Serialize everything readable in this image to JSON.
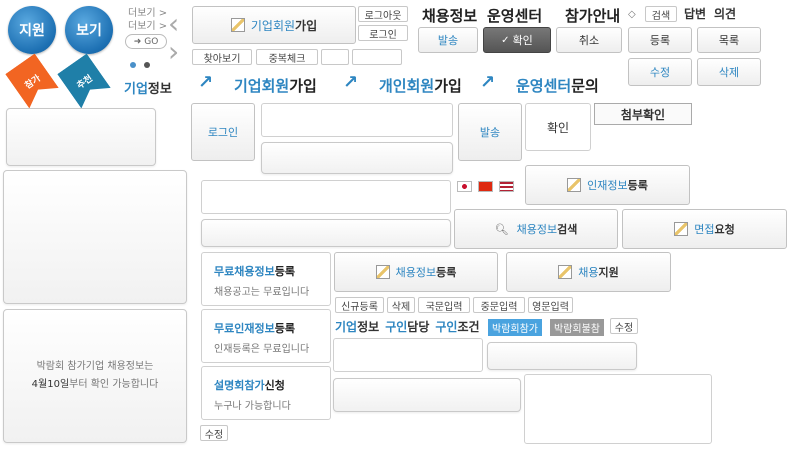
{
  "top_circles": [
    {
      "label": "지원"
    },
    {
      "label": "보기"
    }
  ],
  "ribbons": [
    {
      "label": "참가",
      "color": "#f26522"
    },
    {
      "label": "추천",
      "color": "#1f7fa8"
    }
  ],
  "more_links": [
    "더보기 >",
    "더보기 >"
  ],
  "go_label": "GO",
  "company_info_label": {
    "part1": "기업",
    "part2": "정보"
  },
  "header": {
    "corp_signup": {
      "part1": "기업회원",
      "part2": "가입"
    },
    "logout": "로그아웃",
    "login": "로그인",
    "favorite": "찾아보기",
    "dup_check": "중복체크",
    "recruit_info": "채용정보",
    "ops_center": "운영센터",
    "guide": "참가안내",
    "search": "검색",
    "answer": "답변",
    "opinion": "의견",
    "send": "발송",
    "confirm": "확인",
    "cancel": "취소",
    "register": "등록",
    "list": "목록",
    "edit": "수정",
    "delete": "삭제"
  },
  "links_row": [
    {
      "part1": "기업회원",
      "part2": "가입"
    },
    {
      "part1": "개인회원",
      "part2": "가입"
    },
    {
      "part1": "운영센터",
      "part2": "문의"
    }
  ],
  "mid": {
    "login": "로그인",
    "send": "발송",
    "confirm": "확인",
    "attach_confirm": "첨부확인",
    "talent_register": {
      "part1": "인재정보",
      "part2": "등록"
    },
    "recruit_search": {
      "part1": "채용정보",
      "part2": "검색"
    },
    "interview_request": {
      "part1": "면접",
      "part2": "요청"
    },
    "recruit_register": {
      "part1": "채용정보",
      "part2": "등록"
    },
    "recruit_apply": {
      "part1": "채용",
      "part2": "지원"
    }
  },
  "cards": [
    {
      "title": {
        "part1": "무료",
        "part2": "채용정보",
        "part3": "등록"
      },
      "sub": "채용공고는 무료입니다"
    },
    {
      "title": {
        "part1": "무료",
        "part2": "인재정보",
        "part3": "등록"
      },
      "sub": "인재등록은 무료입니다"
    },
    {
      "title": {
        "part1": "설명회",
        "part2": "참가",
        "part3": "신청"
      },
      "sub": "누구나 가능합니다"
    }
  ],
  "small_buttons": [
    "신규등록",
    "삭제",
    "국문입력",
    "중문입력",
    "영문입력"
  ],
  "info_row": {
    "corp": {
      "part1": "기업",
      "part2": "정보"
    },
    "contact": {
      "part1": "구인",
      "part2": "담당"
    },
    "cond": {
      "part1": "구인",
      "part2": "조건"
    },
    "tag_blue": "박람회참가",
    "tag_gray": "박람회불참",
    "edit": "수정"
  },
  "notice": {
    "line1": "박람회 참가기업 채용정보는",
    "line2_a": "4월10일",
    "line2_b": "부터 확인 가능합니다"
  },
  "bottom_edit": "수정"
}
